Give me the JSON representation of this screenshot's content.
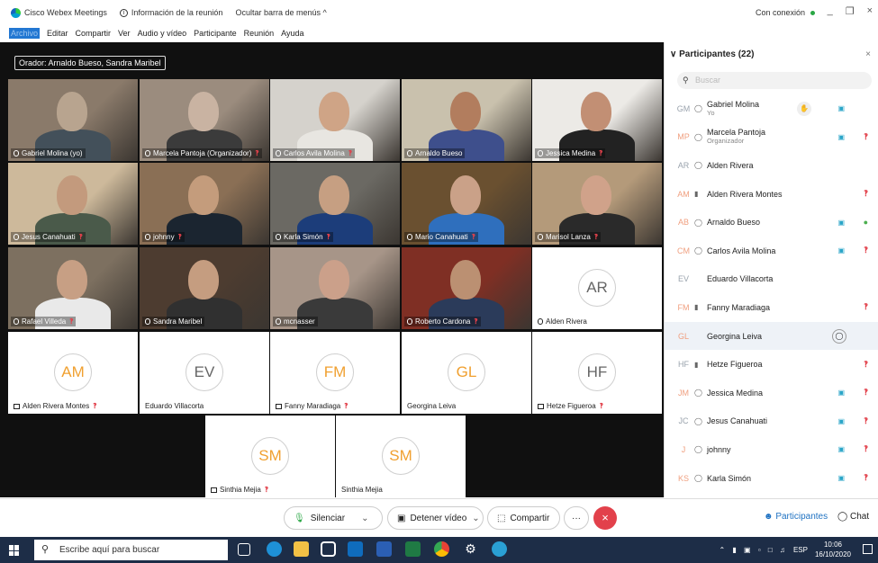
{
  "titlebar": {
    "app_name": "Cisco Webex Meetings",
    "meeting_info": "Información de la reunión",
    "hide_menu": "Ocultar barra de menús ^",
    "status": "Con conexión",
    "win_min": "_",
    "win_restore": "❐",
    "win_close": "×"
  },
  "menu": [
    "Archivo",
    "Editar",
    "Compartir",
    "Ver",
    "Audio y vídeo",
    "Participante",
    "Reunión",
    "Ayuda"
  ],
  "speaker_label": "Orador: Arnaldo Bueso, Sandra Maribel",
  "tiles": [
    {
      "name": "Gabriel Molina (yo)",
      "icon": "mic",
      "muted": false,
      "highlight": false
    },
    {
      "name": "Marcela Pantoja (Organizador)",
      "icon": "mic",
      "muted": true,
      "highlight": false
    },
    {
      "name": "Carlos Avila Molina",
      "icon": "mic",
      "muted": true,
      "highlight": false
    },
    {
      "name": "Arnaldo Bueso",
      "icon": "mic",
      "muted": false,
      "highlight": true
    },
    {
      "name": "Jessica Medina",
      "icon": "mic",
      "muted": true,
      "highlight": false
    },
    {
      "name": "Jesus Canahuati",
      "icon": "mic",
      "muted": true,
      "highlight": false
    },
    {
      "name": "johnny",
      "icon": "mic",
      "muted": true,
      "highlight": false
    },
    {
      "name": "Karla Simón",
      "icon": "mic",
      "muted": true,
      "highlight": false
    },
    {
      "name": "Mario Canahuati",
      "icon": "mic",
      "muted": true,
      "highlight": false
    },
    {
      "name": "Marisol Lanza",
      "icon": "mic",
      "muted": true,
      "highlight": false
    },
    {
      "name": "Rafael Villeda",
      "icon": "mic",
      "muted": true,
      "highlight": false
    },
    {
      "name": "Sandra Maribel",
      "icon": "mic",
      "muted": false,
      "highlight": true
    },
    {
      "name": "mcnasser",
      "icon": "mic",
      "muted": false,
      "highlight": false
    },
    {
      "name": "Roberto Cardona",
      "icon": "mic",
      "muted": true,
      "highlight": false
    },
    {
      "name": "Alden Rivera",
      "icon": "mic",
      "muted": false,
      "highlight": false,
      "initials": "AR",
      "initials_color": "gray"
    },
    {
      "name": "Alden Rivera Montes",
      "icon": "screen",
      "muted": true,
      "highlight": false,
      "initials": "AM",
      "initials_color": "orange"
    },
    {
      "name": "Eduardo Villacorta",
      "icon": "none",
      "muted": false,
      "highlight": false,
      "initials": "EV",
      "initials_color": "gray"
    },
    {
      "name": "Fanny Maradiaga",
      "icon": "screen",
      "muted": true,
      "highlight": false,
      "initials": "FM",
      "initials_color": "orange"
    },
    {
      "name": "Georgina Leiva",
      "icon": "none",
      "muted": false,
      "highlight": false,
      "initials": "GL",
      "initials_color": "orange"
    },
    {
      "name": "Hetze Figueroa",
      "icon": "screen",
      "muted": true,
      "highlight": false,
      "initials": "HF",
      "initials_color": "gray"
    },
    {
      "name": "Sinthia Mejia",
      "icon": "screen",
      "muted": true,
      "highlight": false,
      "initials": "SM",
      "initials_color": "orange"
    },
    {
      "name": "Sinthia Mejia",
      "icon": "none",
      "muted": false,
      "highlight": false,
      "initials": "SM",
      "initials_color": "orange"
    }
  ],
  "panel": {
    "title": "Participantes (22)",
    "close": "×",
    "search_placeholder": "Buscar",
    "participants": [
      {
        "initials": "GM",
        "name": "Gabriel Molina",
        "sub": "Yo",
        "device": "mic",
        "cam": true,
        "mic": "none",
        "raise": true
      },
      {
        "initials": "MP",
        "name": "Marcela Pantoja",
        "sub": "Organizador",
        "device": "mic",
        "cam": true,
        "mic": "muted"
      },
      {
        "initials": "AR",
        "name": "Alden Rivera",
        "sub": "",
        "device": "mic",
        "cam": false,
        "mic": "none"
      },
      {
        "initials": "AM",
        "name": "Alden Rivera Montes",
        "sub": "",
        "device": "screen",
        "cam": false,
        "mic": "muted"
      },
      {
        "initials": "AB",
        "name": "Arnaldo Bueso",
        "sub": "",
        "device": "mic",
        "cam": true,
        "mic": "active"
      },
      {
        "initials": "CM",
        "name": "Carlos Avila Molina",
        "sub": "",
        "device": "mic",
        "cam": true,
        "mic": "muted"
      },
      {
        "initials": "EV",
        "name": "Eduardo Villacorta",
        "sub": "",
        "device": "none",
        "cam": false,
        "mic": "none"
      },
      {
        "initials": "FM",
        "name": "Fanny Maradiaga",
        "sub": "",
        "device": "screen",
        "cam": false,
        "mic": "muted"
      },
      {
        "initials": "GL",
        "name": "Georgina Leiva",
        "sub": "",
        "device": "none",
        "cam": false,
        "mic": "none",
        "chat": true,
        "hover": true
      },
      {
        "initials": "HF",
        "name": "Hetze Figueroa",
        "sub": "",
        "device": "screen",
        "cam": false,
        "mic": "muted"
      },
      {
        "initials": "JM",
        "name": "Jessica Medina",
        "sub": "",
        "device": "mic",
        "cam": true,
        "mic": "muted"
      },
      {
        "initials": "JC",
        "name": "Jesus Canahuati",
        "sub": "",
        "device": "mic",
        "cam": true,
        "mic": "muted"
      },
      {
        "initials": "J",
        "name": "johnny",
        "sub": "",
        "device": "mic",
        "cam": true,
        "mic": "muted"
      },
      {
        "initials": "KS",
        "name": "Karla Simón",
        "sub": "",
        "device": "mic",
        "cam": true,
        "mic": "muted"
      }
    ]
  },
  "controls": {
    "mute": "Silenciar",
    "stop_video": "Detener vídeo",
    "share": "Compartir",
    "more": "···",
    "end": "×",
    "participants": "Participantes",
    "chat": "Chat"
  },
  "taskbar": {
    "search_placeholder": "Escribe aquí para buscar",
    "lang": "ESP",
    "time": "10:06",
    "date": "16/10/2020"
  }
}
